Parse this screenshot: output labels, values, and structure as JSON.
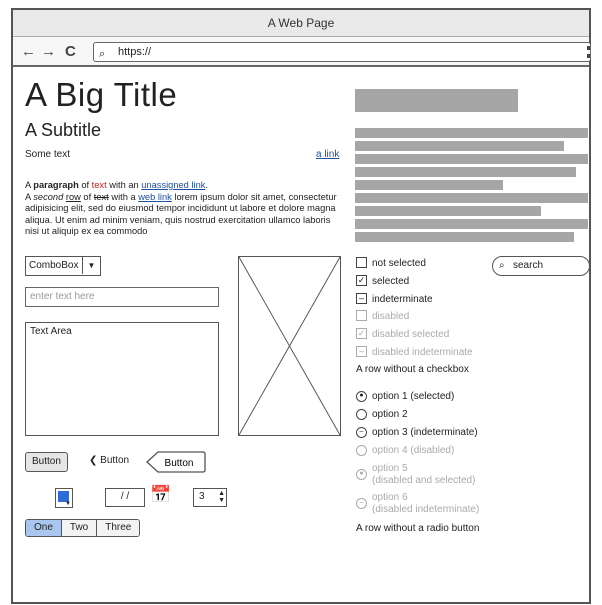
{
  "window": {
    "title": "A Web Page"
  },
  "nav": {
    "url": "https://",
    "back": "←",
    "forward": "→",
    "reload": "C"
  },
  "content": {
    "title": "A Big Title",
    "subtitle": "A Subtitle",
    "some_text": "Some text",
    "a_link": "a link",
    "paragraph": {
      "p1_a": "A ",
      "p1_bold": "paragraph",
      "p1_b": " of ",
      "p1_red": "text",
      "p1_c": " with an ",
      "p1_link": "unassigned link",
      "p1_d": ".",
      "p2_a": "A ",
      "p2_italic": "second",
      "p2_b": " ",
      "p2_under": "row",
      "p2_c": " of ",
      "p2_strike": "text",
      "p2_d": " with a ",
      "p2_link": "web link",
      "p2_rest": " lorem ipsum dolor sit amet, consectetur adipisicing elit, sed do eiusmod tempor incididunt ut labore et dolore magna aliqua. Ut enim ad minim veniam, quis nostrud exercitation ullamco laboris nisi ut aliquip ex ea commodo"
    },
    "combobox": "ComboBox",
    "text_input_placeholder": "enter text here",
    "text_area": "Text Area",
    "button1": "Button",
    "button2": "Button",
    "button3": "Button",
    "date": "/ /",
    "stepper_value": "3",
    "color_accent": "#2f6bd6",
    "segments": [
      "One",
      "Two",
      "Three"
    ]
  },
  "right": {
    "search_placeholder": "search",
    "checkboxes": [
      {
        "label": "not selected",
        "mark": ""
      },
      {
        "label": "selected",
        "mark": "✓"
      },
      {
        "label": "indeterminate",
        "mark": "–"
      },
      {
        "label": "disabled",
        "mark": ""
      },
      {
        "label": "disabled selected",
        "mark": "✓"
      },
      {
        "label": "disabled indeterminate",
        "mark": "–"
      }
    ],
    "row_no_checkbox": "A row without a checkbox",
    "radios": [
      {
        "label": "option 1 (selected)",
        "mark": "●"
      },
      {
        "label": "option 2",
        "mark": ""
      },
      {
        "label": "option 3 (indeterminate)",
        "mark": "–"
      },
      {
        "label": "option 4 (disabled)",
        "mark": ""
      },
      {
        "label": "option 5",
        "label2": "(disabled and selected)",
        "mark": "●"
      },
      {
        "label": "option 6",
        "label2": "(disabled indeterminate)",
        "mark": "–"
      }
    ],
    "row_no_radio": "A row without a radio button"
  }
}
